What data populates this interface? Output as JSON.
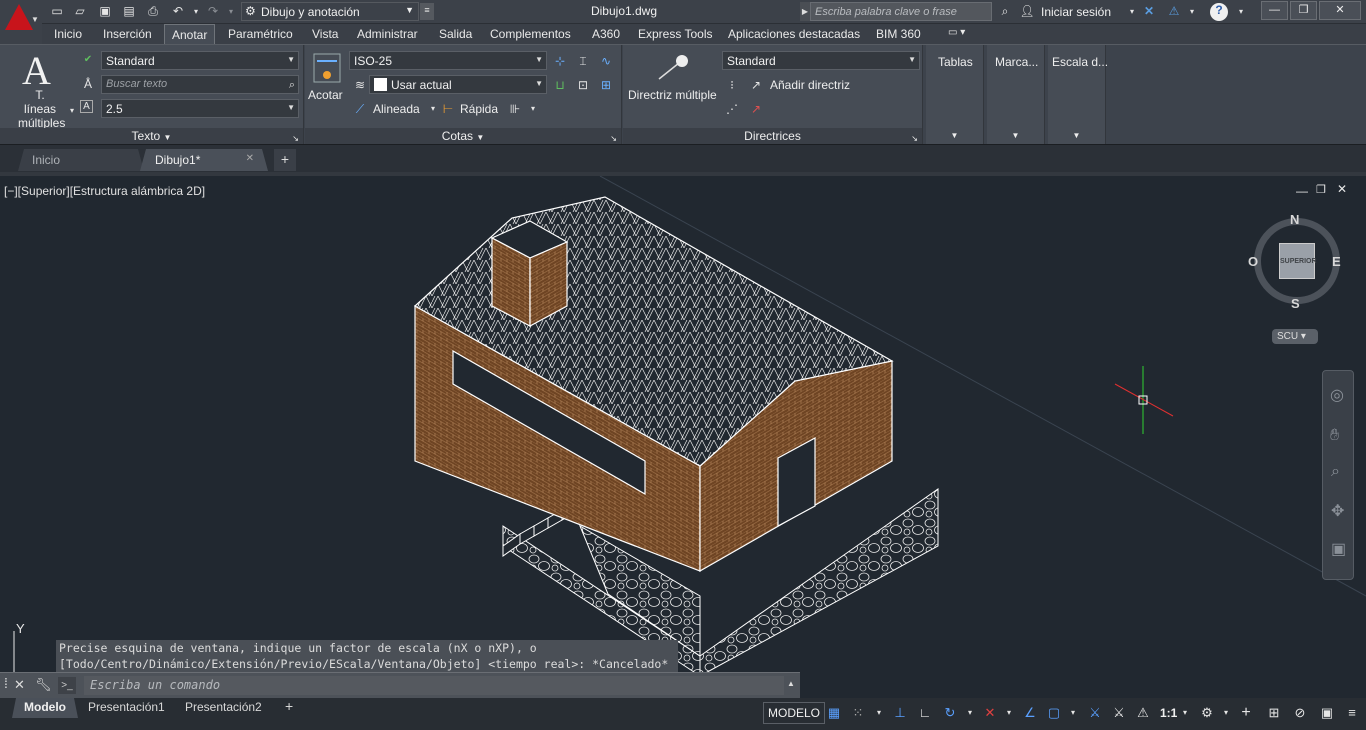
{
  "titlebar": {
    "workspace": "Dibujo y anotación",
    "doc_title": "Dibujo1.dwg",
    "search_placeholder": "Escriba palabra clave o frase",
    "signin": "Iniciar sesión"
  },
  "ribbon_tabs": [
    "Inicio",
    "Inserción",
    "Anotar",
    "Paramétrico",
    "Vista",
    "Administrar",
    "Salida",
    "Complementos",
    "A360",
    "Express Tools",
    "Aplicaciones destacadas",
    "BIM 360"
  ],
  "active_tab": "Anotar",
  "panels": {
    "texto": {
      "big_button": "T. líneas múltiples",
      "style": "Standard",
      "search_placeholder": "Buscar texto",
      "height": "2.5",
      "title": "Texto"
    },
    "cotas": {
      "big_button": "Acotar",
      "style": "ISO-25",
      "layer": "Usar actual",
      "aligned": "Alineada",
      "quick": "Rápida",
      "title": "Cotas"
    },
    "directrices": {
      "big_button": "Directriz múltiple",
      "style": "Standard",
      "add": "Añadir directriz",
      "title": "Directrices"
    },
    "tablas": {
      "title": "Tablas"
    },
    "marca": {
      "title": "Marca..."
    },
    "escala": {
      "title": "Escala d..."
    }
  },
  "doc_tabs": [
    "Inicio",
    "Dibujo1*"
  ],
  "viewport": {
    "label": "[−][Superior][Estructura alámbrica 2D]",
    "viewcube": {
      "face": "SUPERIOR",
      "n": "N",
      "s": "S",
      "e": "E",
      "w": "O",
      "ucs": "SCU"
    }
  },
  "command": {
    "history": [
      "Precise esquina de ventana, indique un factor de escala (nX o nXP), o",
      "[Todo/Centro/Dinámico/Extensión/Previo/EScala/Ventana/Objeto] <tiempo real>: *Cancelado*"
    ],
    "placeholder": "Escriba un comando"
  },
  "layout_tabs": [
    "Modelo",
    "Presentación1",
    "Presentación2"
  ],
  "status": {
    "model": "MODELO",
    "scale": "1:1"
  },
  "colors": {
    "brick": "#6e4423",
    "background": "#212830",
    "logo": "#c8141b"
  }
}
